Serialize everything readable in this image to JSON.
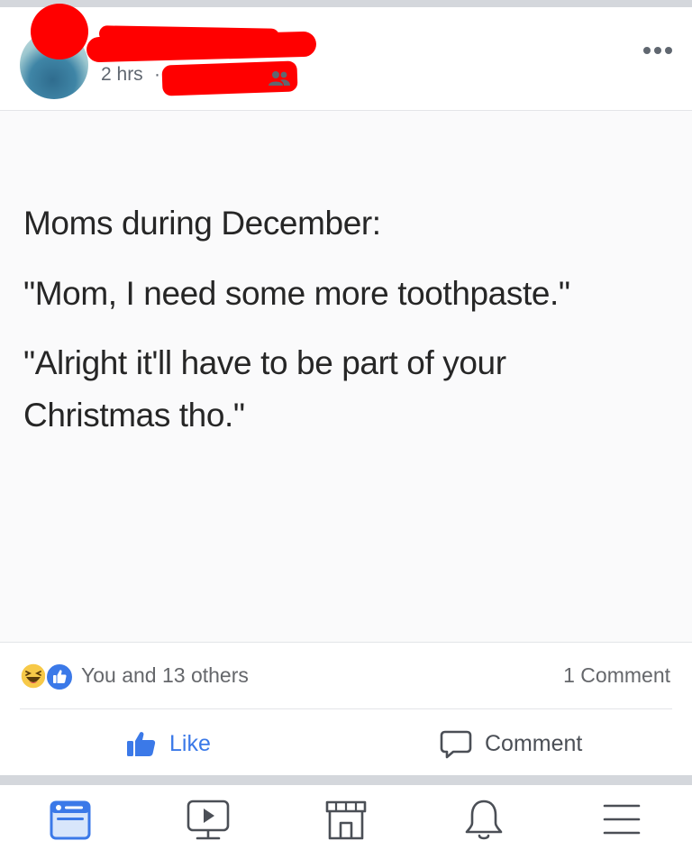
{
  "post": {
    "time": "2 hrs",
    "separator": "·",
    "audience_icon": "friends-icon",
    "menu_icon": "more-icon",
    "lines": [
      "Moms during December:",
      "\"Mom, I need some more toothpaste.\"",
      "\"Alright it'll have to be part of your",
      "Christmas tho.\""
    ]
  },
  "reactions": {
    "icons": [
      "haha-icon",
      "like-icon"
    ],
    "summary": "You and 13 others",
    "comments": "1 Comment"
  },
  "actions": {
    "like_label": "Like",
    "comment_label": "Comment"
  },
  "nav": {
    "items": [
      "news-feed-icon",
      "watch-icon",
      "marketplace-icon",
      "notifications-icon",
      "menu-icon"
    ]
  },
  "colors": {
    "accent": "#3b79e8",
    "redaction": "#ff0000",
    "band": "#d4d7dc"
  }
}
